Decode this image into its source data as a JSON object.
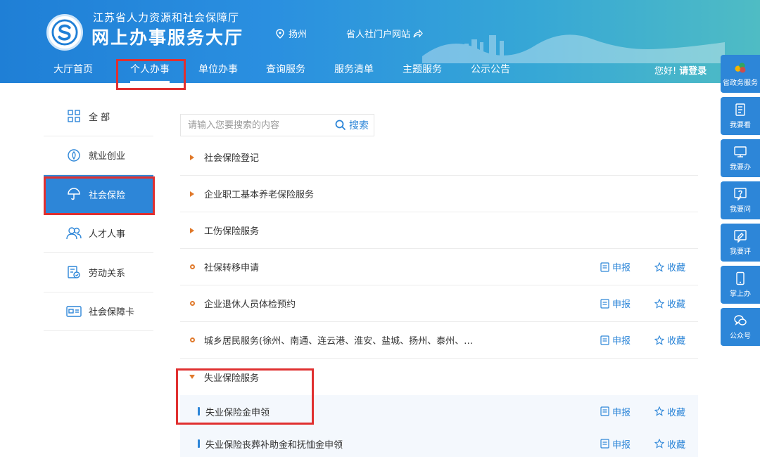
{
  "header": {
    "org_name": "江苏省人力资源和社会保障厅",
    "hall_name": "网上办事服务大厅",
    "location": "扬州",
    "portal_link": "省人社门户网站",
    "greeting": "您好!",
    "login": "请登录"
  },
  "nav": {
    "items": [
      {
        "label": "大厅首页"
      },
      {
        "label": "个人办事"
      },
      {
        "label": "单位办事"
      },
      {
        "label": "查询服务"
      },
      {
        "label": "服务清单"
      },
      {
        "label": "主题服务"
      },
      {
        "label": "公示公告"
      }
    ],
    "active": "个人办事"
  },
  "sidebar": {
    "items": [
      {
        "label": "全 部",
        "icon": "grid-icon"
      },
      {
        "label": "就业创业",
        "icon": "employment-icon"
      },
      {
        "label": "社会保险",
        "icon": "umbrella-icon"
      },
      {
        "label": "人才人事",
        "icon": "people-icon"
      },
      {
        "label": "劳动关系",
        "icon": "labor-doc-icon"
      },
      {
        "label": "社会保障卡",
        "icon": "card-icon"
      }
    ],
    "active": "社会保险"
  },
  "search": {
    "placeholder": "请输入您要搜索的内容",
    "button": "搜索"
  },
  "services": [
    {
      "label": "社会保险登记",
      "type": "category"
    },
    {
      "label": "企业职工基本养老保险服务",
      "type": "category"
    },
    {
      "label": "工伤保险服务",
      "type": "category"
    },
    {
      "label": "社保转移申请",
      "type": "item",
      "apply": "申报",
      "favorite": "收藏"
    },
    {
      "label": "企业退休人员体检预约",
      "type": "item",
      "apply": "申报",
      "favorite": "收藏"
    },
    {
      "label": "城乡居民服务(徐州、南通、连云港、淮安、盐城、扬州、泰州、…",
      "type": "item",
      "apply": "申报",
      "favorite": "收藏"
    },
    {
      "label": "失业保险服务",
      "type": "category-open"
    },
    {
      "label": "失业保险金申领",
      "type": "sub-item",
      "apply": "申报",
      "favorite": "收藏"
    },
    {
      "label": "失业保险丧葬补助金和抚恤金申领",
      "type": "sub-item",
      "apply": "申报",
      "favorite": "收藏"
    }
  ],
  "float_toolbar": [
    {
      "label": "省政务服务",
      "icon": "gov-service-icon"
    },
    {
      "label": "我要看",
      "icon": "book-icon"
    },
    {
      "label": "我要办",
      "icon": "monitor-icon"
    },
    {
      "label": "我要问",
      "icon": "question-icon"
    },
    {
      "label": "我要评",
      "icon": "review-icon"
    },
    {
      "label": "掌上办",
      "icon": "phone-icon"
    },
    {
      "label": "公众号",
      "icon": "wechat-icon"
    }
  ],
  "colors": {
    "primary": "#2d86d8",
    "accent": "#e0792b",
    "highlight": "#e03030"
  }
}
